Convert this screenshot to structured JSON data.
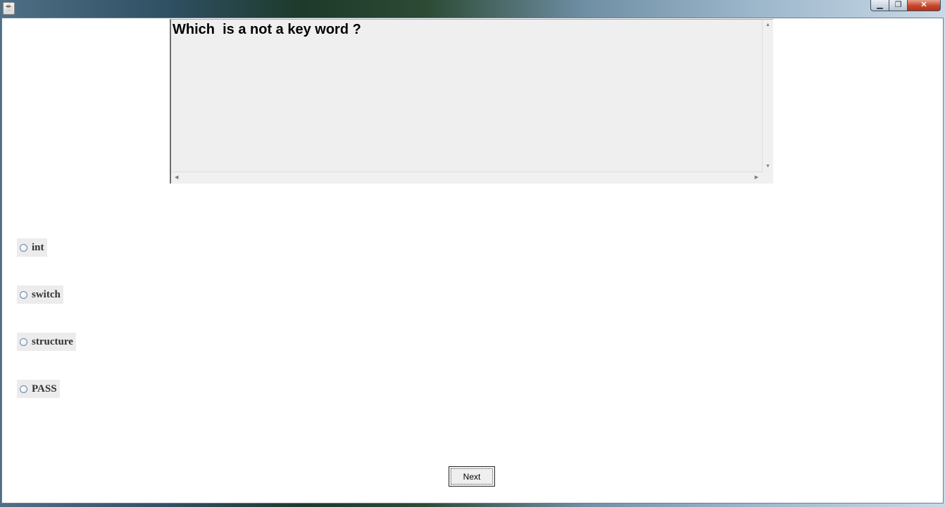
{
  "window": {
    "controls": {
      "minimize_icon": "minimize-icon",
      "maximize_icon": "maximize-icon",
      "close_icon": "close-icon"
    }
  },
  "question": {
    "text": "Which  is a not a key word ?"
  },
  "options": [
    {
      "label": "int",
      "selected": false
    },
    {
      "label": "switch",
      "selected": false
    },
    {
      "label": "structure",
      "selected": false
    },
    {
      "label": "PASS",
      "selected": false
    }
  ],
  "next_label": "Next",
  "colors": {
    "close_button": "#c7452a",
    "question_background": "#efefef"
  }
}
